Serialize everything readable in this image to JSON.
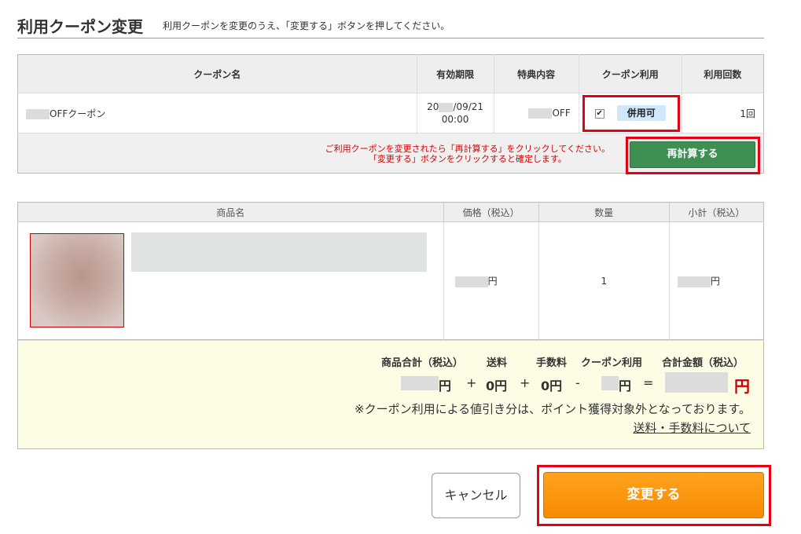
{
  "header": {
    "title": "利用クーポン変更",
    "subtitle": "利用クーポンを変更のうえ、「変更する」ボタンを押してください。"
  },
  "coupon_table": {
    "headers": [
      "クーポン名",
      "有効期限",
      "特典内容",
      "クーポン利用",
      "利用回数"
    ],
    "row": {
      "name_suffix": "OFFクーポン",
      "expiry_prefix": "20",
      "expiry_suffix": "/09/21",
      "expiry_time": "00:00",
      "benefit_suffix": "OFF",
      "use_checked": true,
      "combo_badge": "併用可",
      "use_count": "1回"
    },
    "recalc_message_1": "ご利用クーポンを変更されたら「再計算する」をクリックしてください。",
    "recalc_message_2": "「変更する」ボタンをクリックすると確定します。",
    "recalc_button": "再計算する"
  },
  "product_table": {
    "headers": [
      "商品名",
      "価格（税込）",
      "数量",
      "小計（税込）"
    ],
    "row": {
      "price_unit": "円",
      "quantity": "1",
      "subtotal_unit": "円"
    }
  },
  "summary": {
    "labels": [
      "商品合計（税込）",
      "送料",
      "手数料",
      "クーポン利用",
      "合計金額（税込）"
    ],
    "goods_unit": "円",
    "shipping": "0円",
    "fee": "0円",
    "coupon_unit": "円",
    "total_unit": "円",
    "ops": [
      "+",
      "+",
      "-",
      "="
    ],
    "note": "※クーポン利用による値引き分は、ポイント獲得対象外となっております。",
    "link": "送料・手数料について"
  },
  "buttons": {
    "cancel": "キャンセル",
    "change": "変更する"
  },
  "colors": {
    "recalc_button": "#3e8f52",
    "change_button": "#f68a00",
    "highlight_border": "#e60012",
    "message_red": "#d80000"
  }
}
